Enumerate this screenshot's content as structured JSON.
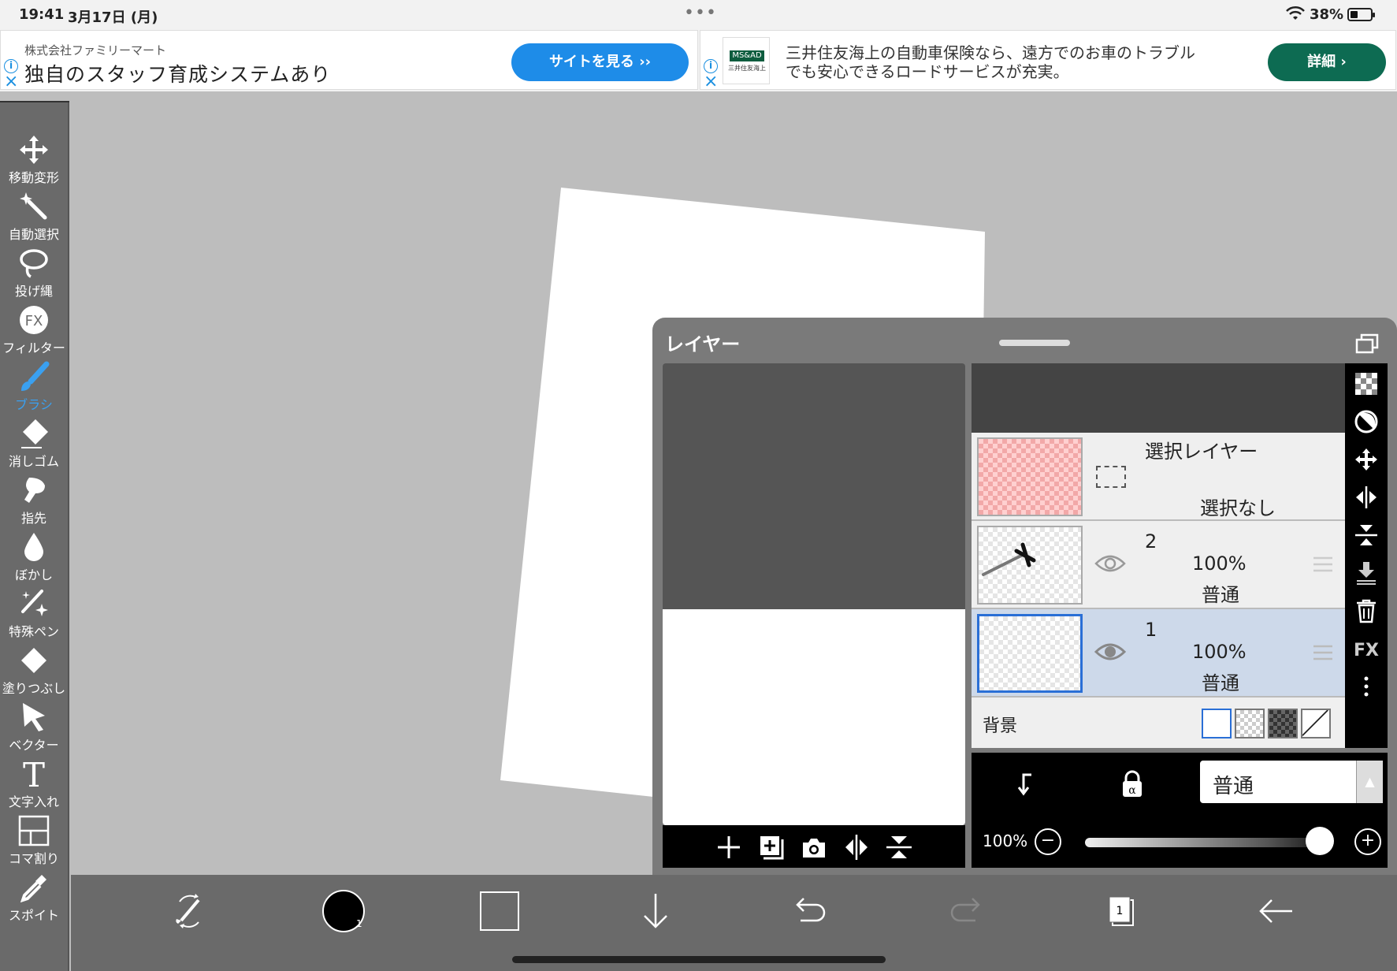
{
  "status_bar": {
    "time": "19:41",
    "date": "3月17日 (月)",
    "battery": "38%"
  },
  "ads": {
    "left": {
      "company": "株式会社ファミリーマート",
      "headline": "独自のスタッフ育成システムあり",
      "cta": "サイトを見る ››"
    },
    "right": {
      "logo_text": "MS&AD",
      "logo_sub": "三井住友海上",
      "line1": "三井住友海上の自動車保険なら、遠方でのお車のトラブル",
      "line2": "でも安心できるロードサービスが充実。",
      "cta": "詳細 ›"
    }
  },
  "left_toolbar": {
    "tools": [
      {
        "id": "move",
        "label": "移動変形"
      },
      {
        "id": "magic",
        "label": "自動選択"
      },
      {
        "id": "lasso",
        "label": "投げ縄"
      },
      {
        "id": "filter",
        "label": "フィルター"
      },
      {
        "id": "brush",
        "label": "ブラシ"
      },
      {
        "id": "eraser",
        "label": "消しゴム"
      },
      {
        "id": "finger",
        "label": "指先"
      },
      {
        "id": "blur",
        "label": "ぼかし"
      },
      {
        "id": "special",
        "label": "特殊ペン"
      },
      {
        "id": "fill",
        "label": "塗りつぶし"
      },
      {
        "id": "vector",
        "label": "ベクター"
      },
      {
        "id": "text",
        "label": "文字入れ"
      },
      {
        "id": "frame",
        "label": "コマ割り"
      },
      {
        "id": "eyedropper",
        "label": "スポイト"
      }
    ],
    "active": "brush",
    "filter_icon_text": "FX",
    "text_icon_text": "T"
  },
  "layer_panel": {
    "title": "レイヤー",
    "selection_layer": {
      "name": "選択レイヤー",
      "status": "選択なし"
    },
    "layers": [
      {
        "name": "2",
        "opacity": "100%",
        "blend": "普通"
      },
      {
        "name": "1",
        "opacity": "100%",
        "blend": "普通"
      }
    ],
    "background_label": "背景",
    "blend_mode": "普通",
    "opacity": "100%",
    "fx_label": "FX"
  },
  "bottom_toolbar": {
    "color_badge": "1",
    "layer_count": "1"
  },
  "colors": {
    "active": "#3aa0f0",
    "selected_layer": "#cdd9ea",
    "toolbar": "#6a6a6a"
  }
}
